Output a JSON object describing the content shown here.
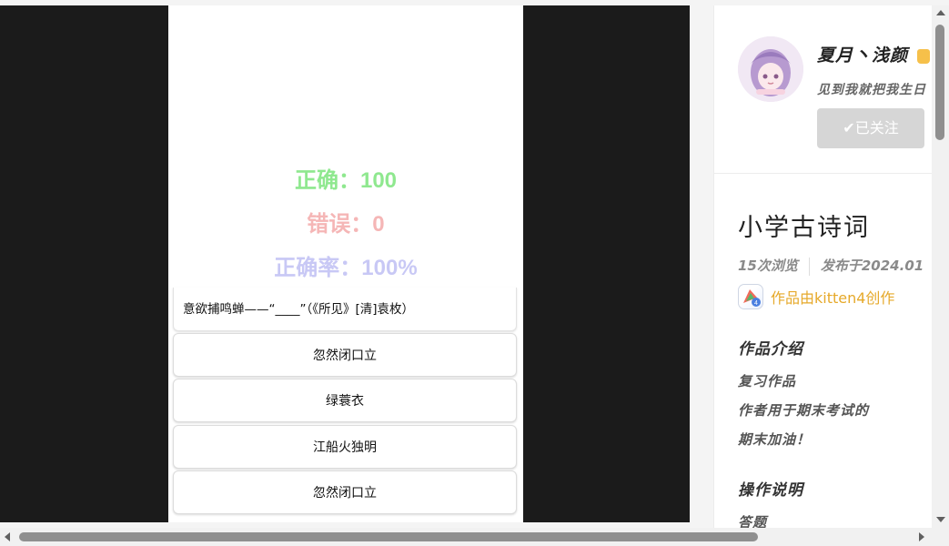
{
  "stage": {
    "stats": {
      "correct": "正确：100",
      "wrong": "错误：0",
      "accuracy": "正确率：100%"
    },
    "stat_colors": {
      "correct": "#8fe88f",
      "wrong": "#f5b6b6",
      "accuracy": "#c8c8f5"
    },
    "question": "意欲捕鸣蝉——“____”（《所见》[清]袁枚）",
    "options": [
      "忽然闭口立",
      "绿蓑衣",
      "江船火独明",
      "忽然闭口立"
    ]
  },
  "author": {
    "name": "夏月丶浅颜",
    "bio": "见到我就把我生日",
    "follow_label": "已关注"
  },
  "work": {
    "title": "小学古诗词",
    "views": "15次浏览",
    "published": "发布于2024.01",
    "tool_label": "作品由kitten4创作",
    "tool_icon_badge": "4",
    "accent_color": "#e6a92a"
  },
  "intro": {
    "heading": "作品介绍",
    "lines": [
      "复习作品",
      "作者用于期末考试的",
      "期末加油！"
    ]
  },
  "operation": {
    "heading": "操作说明",
    "lines": [
      "答题"
    ]
  }
}
